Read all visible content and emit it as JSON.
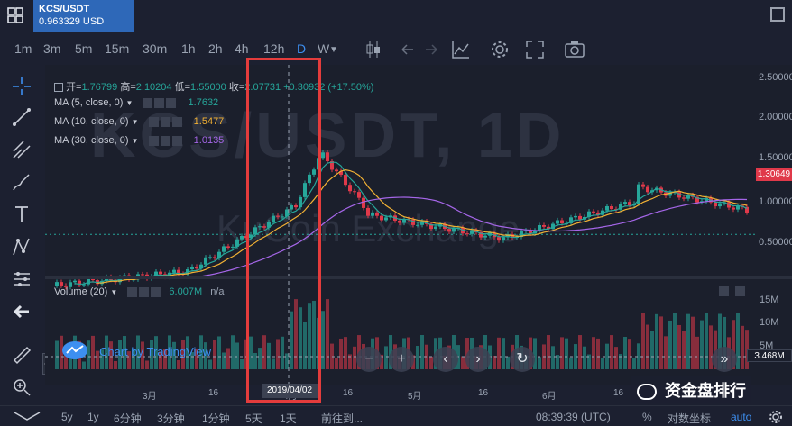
{
  "header": {
    "symbol": "KCS/USDT",
    "price": "0.963329 USD"
  },
  "toolbar": {
    "intervals": [
      "1m",
      "3m",
      "5m",
      "15m",
      "30m",
      "1h",
      "2h",
      "4h",
      "12h",
      "D",
      "W"
    ],
    "active_interval": "D",
    "icons": [
      "candles-icon",
      "undo-icon",
      "redo-icon",
      "compare-icon",
      "settings-gear-icon",
      "fullscreen-icon",
      "camera-icon"
    ]
  },
  "left_tools": [
    "crosshair-icon",
    "trend-line-icon",
    "fib-icon",
    "brush-icon",
    "text-icon",
    "pattern-icon",
    "measure-icon",
    "back-arrow-icon",
    "ruler-icon",
    "zoom-icon",
    "magnet-icon"
  ],
  "ohlc": {
    "open_label": "开=",
    "open": "1.76799",
    "high_label": "高=",
    "high": "2.10204",
    "low_label": "低=",
    "low": "1.55000",
    "close_label": "收=",
    "close": "2.07731",
    "change": "+0.30932 (+17.50%)"
  },
  "indicators": [
    {
      "name": "MA (5, close, 0)",
      "value": "1.7632",
      "color": "#26a69a"
    },
    {
      "name": "MA (10, close, 0)",
      "value": "1.5477",
      "color": "#f2b134"
    },
    {
      "name": "MA (30, close, 0)",
      "value": "1.0135",
      "color": "#a566e8"
    }
  ],
  "volume": {
    "name": "Volume (20)",
    "value": "6.007M",
    "extra": "n/a",
    "axis": [
      "15M",
      "10M",
      "5M"
    ],
    "last": "3.468M"
  },
  "price_axis": [
    "2.50000",
    "2.00000",
    "1.50000",
    "1.00000",
    "0.50000"
  ],
  "last_price": "1.30649",
  "watermark": {
    "line1": "KCS/USDT, 1D",
    "line2": "KuCoin Exchange"
  },
  "tv_logo": "Chart by TradingView",
  "date_axis": [
    "3月",
    "16",
    "4月",
    "16",
    "5月",
    "16",
    "6月",
    "16"
  ],
  "date_cursor": "2019/04/02",
  "bottombar": {
    "ranges": [
      "5y",
      "1y",
      "6分钟",
      "3分钟",
      "1分钟",
      "5天",
      "1天"
    ],
    "goto": "前往到...",
    "time": "08:39:39 (UTC)",
    "percent": "%",
    "log": "对数坐标",
    "auto": "auto"
  },
  "wechat_badge": "资金盘排行",
  "colors": {
    "up": "#26a69a",
    "down": "#e0394a",
    "accent": "#3d8ff0",
    "highlight": "#e43c3c"
  }
}
